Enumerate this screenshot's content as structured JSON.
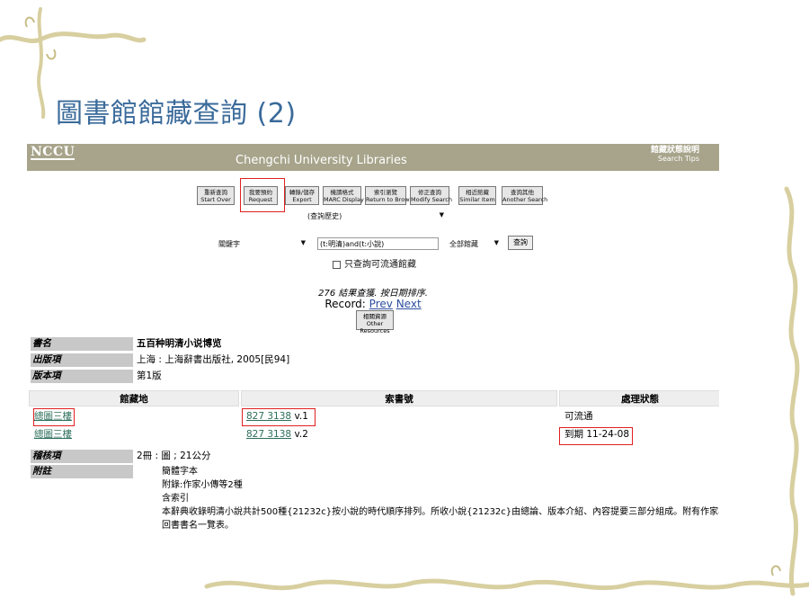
{
  "slide": {
    "title": "圖書館館藏查詢 (2)"
  },
  "header": {
    "logo": "NCCU",
    "site_title": "Chengchi University Libraries",
    "tips_zh": "館藏狀態說明",
    "tips_en": "Search Tips"
  },
  "toolbar": {
    "buttons": [
      {
        "zh": "重新查詢",
        "en": "Start Over"
      },
      {
        "zh": "我要預約",
        "en": "Request"
      },
      {
        "zh": "轉錄/儲存",
        "en": "Export"
      },
      {
        "zh": "機讀格式",
        "en": "MARC Display"
      },
      {
        "zh": "索引瀏覽",
        "en": "Return to Browse"
      },
      {
        "zh": "修正查詢",
        "en": "Modify Search"
      },
      {
        "zh": "相近館藏",
        "en": "Similar Item"
      },
      {
        "zh": "查詢其他",
        "en": "Another Search"
      }
    ],
    "history_select": "(查詢歷史)"
  },
  "search": {
    "field_select": "關鍵字",
    "query": "(t:明清)and(t:小說)",
    "scope_select": "全部館藏",
    "submit_label": "查詢",
    "available_only_label": "只查詢可流通館藏"
  },
  "results": {
    "count_text": "276 結果查獲. 按日期排序.",
    "record_label": "Record:",
    "prev_label": "Prev",
    "next_label": "Next",
    "other_resources_zh": "相關資源",
    "other_resources_en": "Other Resources"
  },
  "bib": {
    "title_label": "書名",
    "title_value": "五百种明清小说博览",
    "pub_label": "出版項",
    "pub_value": "上海 : 上海辭書出版社, 2005[民94]",
    "edition_label": "版本項",
    "edition_value": "第1版",
    "desc_label": "稽核項",
    "desc_value": "2冊 : 圖 ; 21公分",
    "notes_label": "附註",
    "notes": [
      "簡體字本",
      "附錄:作家小傳等2種",
      "含索引",
      "本辭典收錄明清小說共計500種{21232c}按小說的時代順序排列。所收小說{21232c}由總論、版本介紹、內容提要三部分組成。附有作家小傳、",
      "回書書名一覽表。"
    ]
  },
  "holdings": {
    "headers": [
      "館藏地",
      "索書號",
      "處理狀態"
    ],
    "rows": [
      {
        "location": "總圖三樓",
        "callno": "827 3138",
        "vol": "v.1",
        "status": "可流通"
      },
      {
        "location": "總圖三樓",
        "callno": "827 3138",
        "vol": "v.2",
        "status": "到期 11-24-08"
      }
    ]
  },
  "colors": {
    "header_bg": "#a7a48b",
    "highlight": "#e02020",
    "title": "#3a6a9a"
  }
}
